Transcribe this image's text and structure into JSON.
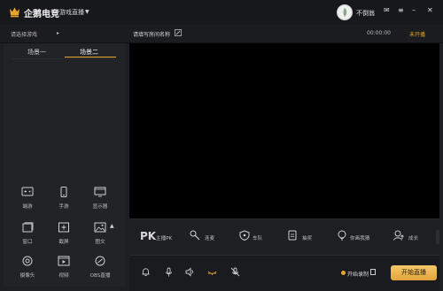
{
  "window": {
    "app_title": "企鹅电竞",
    "mode": "游戏直播",
    "username": "不倒翁",
    "controls": [
      "✉",
      "≡",
      "–",
      "✕"
    ]
  },
  "subbar": {
    "game_select": "请选择游戏",
    "room_name": "请填写房间名称",
    "timer": "00:00:00",
    "live_status": "未开播"
  },
  "scenes": {
    "tab1": "场景一",
    "tab2": "场景二"
  },
  "sources": [
    {
      "label": "端游",
      "icon": "gamepad-icon"
    },
    {
      "label": "手游",
      "icon": "phone-icon"
    },
    {
      "label": "显示器",
      "icon": "monitor-icon"
    },
    {
      "label": "窗口",
      "icon": "window-icon"
    },
    {
      "label": "截屏",
      "icon": "crop-icon"
    },
    {
      "label": "图文",
      "icon": "image-icon"
    },
    {
      "label": "摄像头",
      "icon": "camera-icon"
    },
    {
      "label": "视频",
      "icon": "video-icon"
    },
    {
      "label": "OBS直播",
      "icon": "obs-icon"
    }
  ],
  "tools": [
    {
      "label": "主播PK",
      "icon": "pk-icon"
    },
    {
      "label": "连麦",
      "icon": "link-mic-icon"
    },
    {
      "label": "车队",
      "icon": "shield-icon"
    },
    {
      "label": "抽奖",
      "icon": "lottery-icon"
    },
    {
      "label": "你画我猜",
      "icon": "bulb-icon"
    },
    {
      "label": "成长",
      "icon": "growth-icon"
    }
  ],
  "bottom": {
    "record_label": "开始录制",
    "start_button": "开始直播"
  },
  "colors": {
    "accent": "#e9a52c",
    "background": "#1e1f23",
    "preview": "#000000"
  }
}
